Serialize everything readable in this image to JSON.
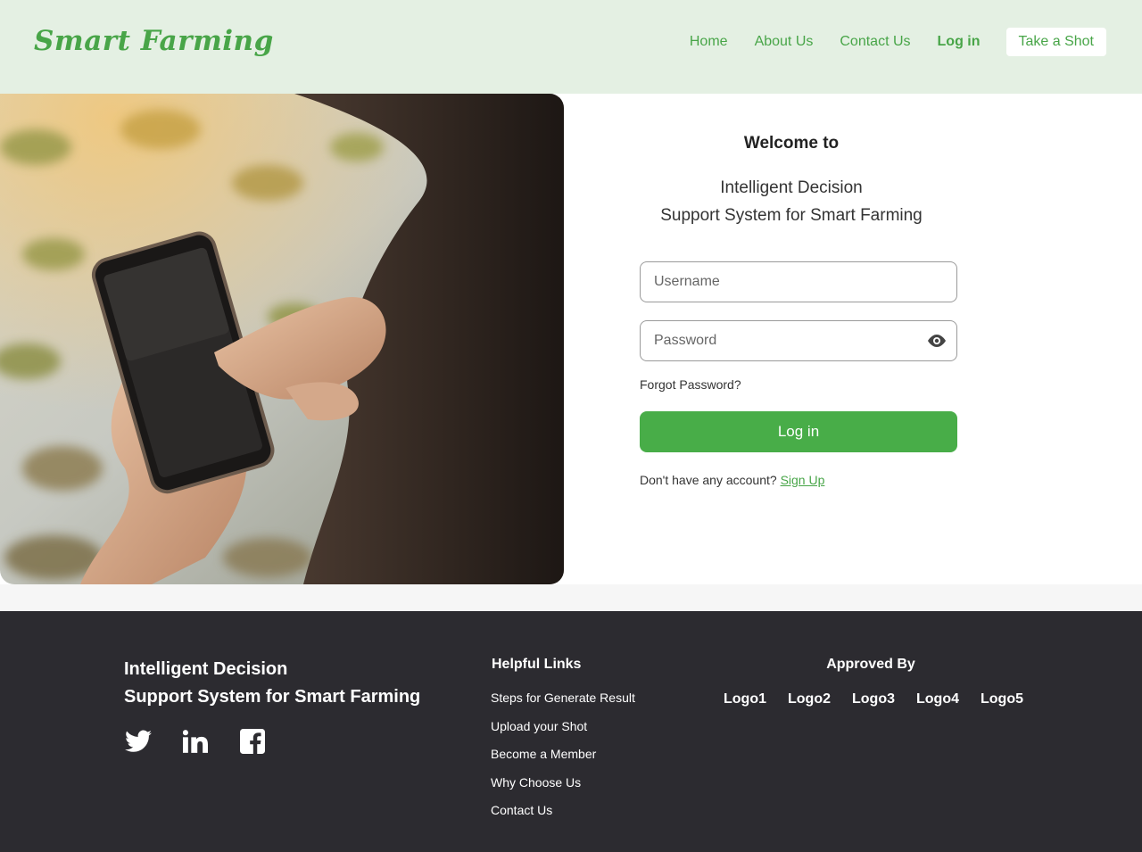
{
  "header": {
    "logo": "Smart Farming",
    "nav": [
      {
        "label": "Home"
      },
      {
        "label": "About Us"
      },
      {
        "label": "Contact Us"
      },
      {
        "label": "Log in"
      }
    ],
    "cta": "Take a Shot"
  },
  "login": {
    "welcome": "Welcome to",
    "subtitle_line1": "Intelligent Decision",
    "subtitle_line2": "Support System for Smart Farming",
    "username_placeholder": "Username",
    "password_placeholder": "Password",
    "forgot": "Forgot Password?",
    "button": "Log in",
    "no_account": "Don't have any account?",
    "signup": "Sign Up"
  },
  "footer": {
    "brand_line1": "Intelligent Decision",
    "brand_line2": "Support System for Smart Farming",
    "socials": [
      "twitter-icon",
      "linkedin-icon",
      "facebook-icon"
    ],
    "links_title": "Helpful Links",
    "links": [
      "Steps for Generate Result",
      "Upload your Shot",
      "Become a Member",
      "Why Choose Us",
      "Contact Us"
    ],
    "approved_title": "Approved By",
    "logos": [
      "Logo1",
      "Logo2",
      "Logo3",
      "Logo4",
      "Logo5"
    ]
  },
  "colors": {
    "brand_green": "#48ad48",
    "header_bg": "#e4f0e3",
    "footer_bg": "#2c2b30"
  }
}
